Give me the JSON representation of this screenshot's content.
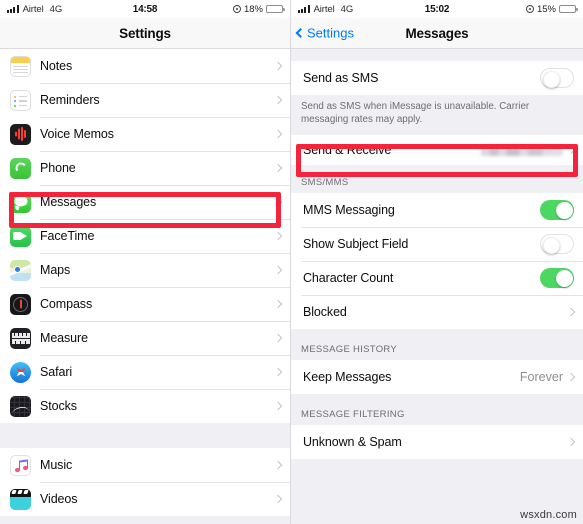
{
  "left_panel": {
    "status_bar": {
      "carrier": "Airtel",
      "network": "4G",
      "time": "14:58",
      "battery_percent": "18%",
      "battery_level": 18,
      "signal_icon": "cellular-bars-icon",
      "location_icon": "location-services-icon",
      "battery_icon": "battery-icon"
    },
    "nav": {
      "title": "Settings"
    },
    "sections": [
      {
        "id": "apps",
        "rows": [
          {
            "label": "Notes",
            "icon": "notes-icon",
            "accessory": "chevron"
          },
          {
            "label": "Reminders",
            "icon": "reminders-icon",
            "accessory": "chevron"
          },
          {
            "label": "Voice Memos",
            "icon": "voice-memos-icon",
            "accessory": "chevron"
          },
          {
            "label": "Phone",
            "icon": "phone-icon",
            "accessory": "chevron"
          },
          {
            "label": "Messages",
            "icon": "messages-icon",
            "accessory": "chevron",
            "highlighted": true
          },
          {
            "label": "FaceTime",
            "icon": "facetime-icon",
            "accessory": "chevron"
          },
          {
            "label": "Maps",
            "icon": "maps-icon",
            "accessory": "chevron"
          },
          {
            "label": "Compass",
            "icon": "compass-icon",
            "accessory": "chevron"
          },
          {
            "label": "Measure",
            "icon": "measure-icon",
            "accessory": "chevron"
          },
          {
            "label": "Safari",
            "icon": "safari-icon",
            "accessory": "chevron"
          },
          {
            "label": "Stocks",
            "icon": "stocks-icon",
            "accessory": "chevron"
          }
        ]
      },
      {
        "id": "media",
        "rows": [
          {
            "label": "Music",
            "icon": "music-icon",
            "accessory": "chevron"
          },
          {
            "label": "Videos",
            "icon": "videos-icon",
            "accessory": "chevron"
          }
        ]
      }
    ]
  },
  "right_panel": {
    "status_bar": {
      "carrier": "Airtel",
      "network": "4G",
      "time": "15:02",
      "battery_percent": "15%",
      "battery_level": 15,
      "signal_icon": "cellular-bars-icon",
      "location_icon": "location-services-icon",
      "battery_icon": "battery-icon"
    },
    "nav": {
      "back_label": "Settings",
      "title": "Messages",
      "back_icon": "chevron-left-icon"
    },
    "rows": {
      "send_as_sms": {
        "label": "Send as SMS",
        "toggle": "off"
      },
      "send_as_sms_footnote": "Send as SMS when iMessage is unavailable. Carrier messaging rates may apply.",
      "send_receive": {
        "label": "Send & Receive",
        "value": "",
        "value_redacted": true,
        "accessory": "chevron",
        "highlighted": true
      },
      "sms_mms_header": "SMS/MMS",
      "mms_messaging": {
        "label": "MMS Messaging",
        "toggle": "on"
      },
      "show_subject_field": {
        "label": "Show Subject Field",
        "toggle": "off"
      },
      "character_count": {
        "label": "Character Count",
        "toggle": "on"
      },
      "blocked": {
        "label": "Blocked",
        "accessory": "chevron"
      },
      "message_history_header": "MESSAGE HISTORY",
      "keep_messages": {
        "label": "Keep Messages",
        "value": "Forever",
        "accessory": "chevron"
      },
      "message_filtering_header": "MESSAGE FILTERING",
      "unknown_and_spam": {
        "label": "Unknown & Spam",
        "accessory": "chevron"
      }
    }
  },
  "watermark": "wsxdn.com",
  "colors": {
    "accent_blue": "#007aff",
    "toggle_on_green": "#4cd763",
    "highlight_red": "#f4243c",
    "group_bg": "#efeff4",
    "secondary_text": "#8e8e93"
  }
}
